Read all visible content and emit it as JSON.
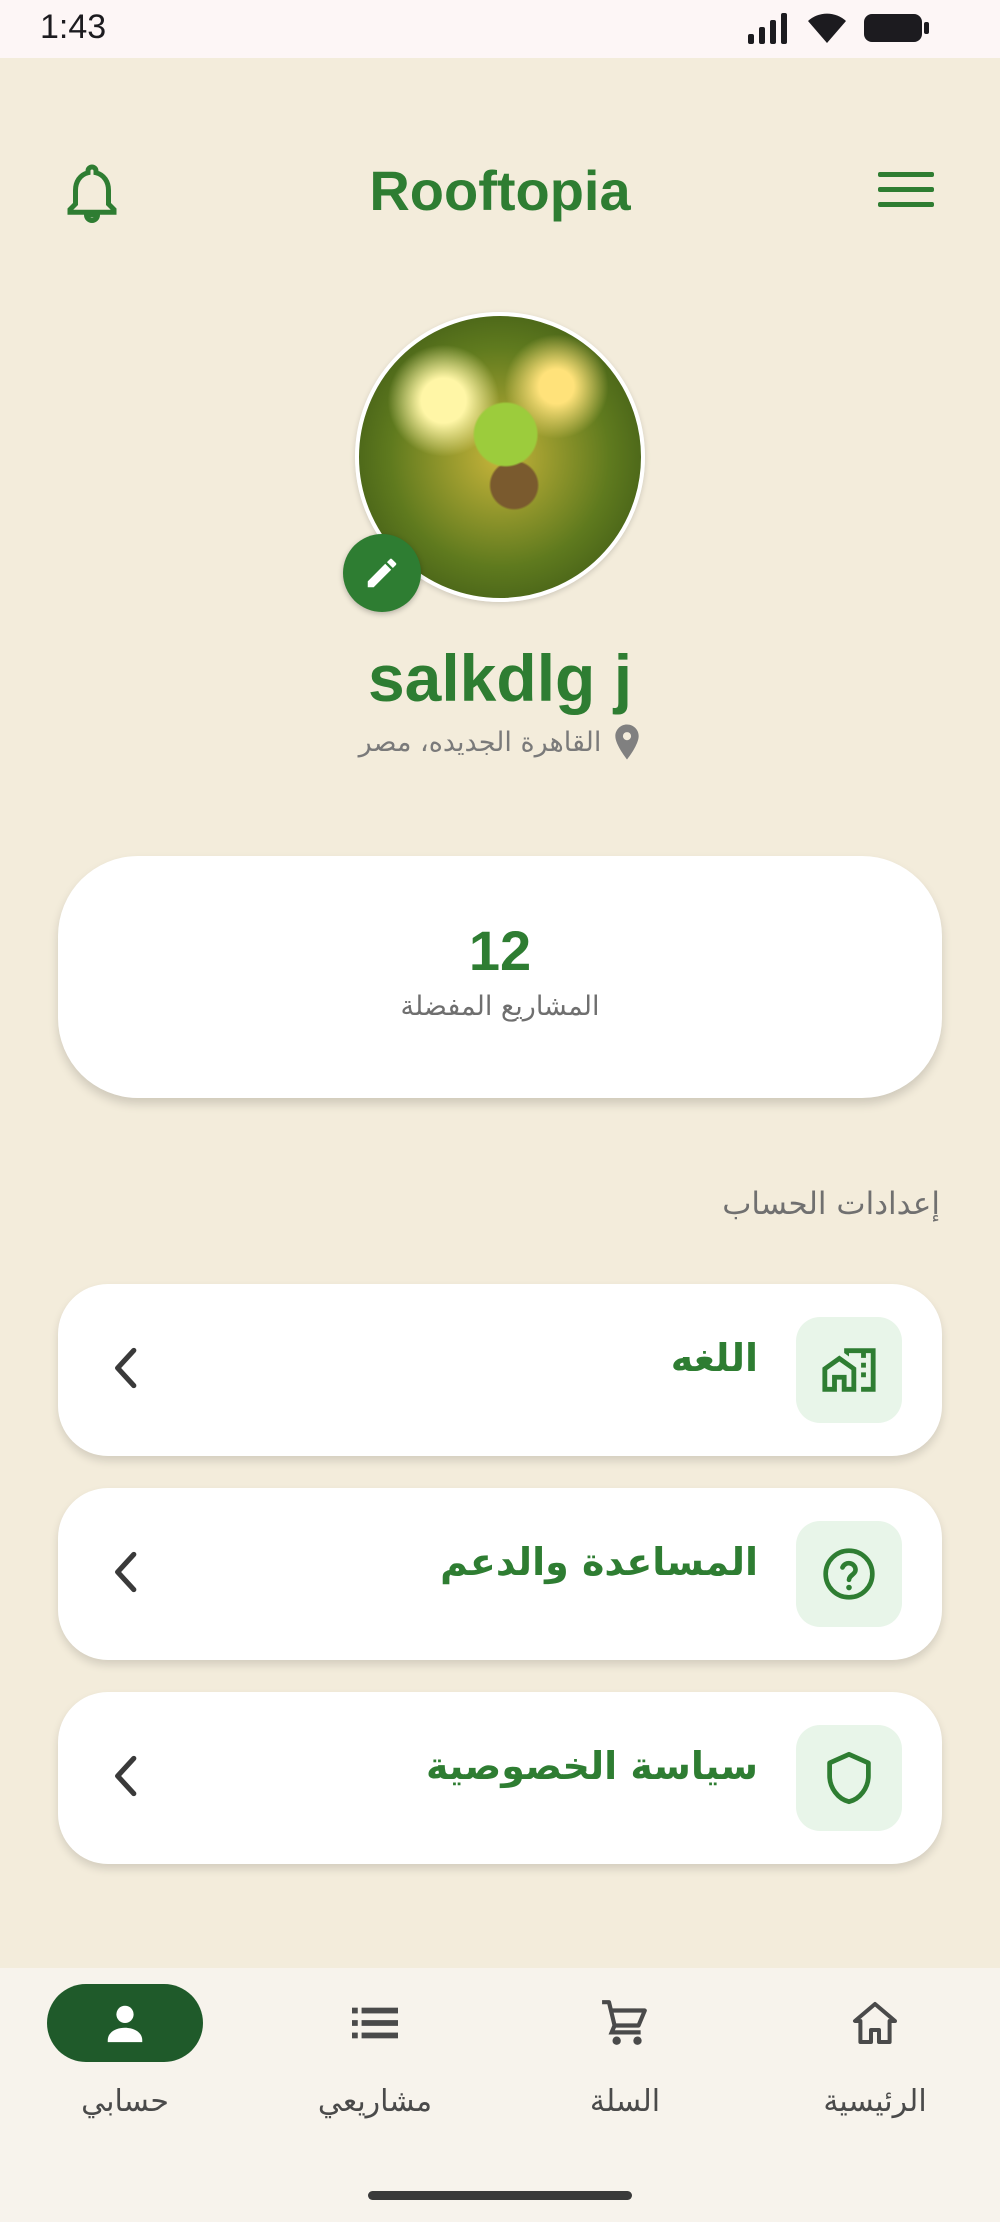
{
  "status_bar": {
    "time": "1:43"
  },
  "header": {
    "title": "Rooftopia"
  },
  "profile": {
    "name": "salkdlg j",
    "location": "القاهرة الجديده، مصر"
  },
  "stats": {
    "value": "12",
    "label": "المشاريع المفضلة"
  },
  "settings": {
    "section_title": "إعدادات الحساب",
    "items": [
      {
        "label": "اللغه",
        "icon": "home-work-icon"
      },
      {
        "label": "المساعدة والدعم",
        "icon": "help-circle-icon"
      },
      {
        "label": "سياسة الخصوصية",
        "icon": "shield-icon"
      }
    ]
  },
  "bottom_nav": {
    "items": [
      {
        "label": "حسابي",
        "icon": "person-icon",
        "active": true
      },
      {
        "label": "مشاريعي",
        "icon": "list-icon",
        "active": false
      },
      {
        "label": "السلة",
        "icon": "cart-icon",
        "active": false
      },
      {
        "label": "الرئيسية",
        "icon": "home-icon",
        "active": false
      }
    ]
  },
  "colors": {
    "primary": "#2e7d32",
    "nav_active": "#1f5a2a",
    "background": "#f3ecdb",
    "icon_box": "#e8f5e9"
  }
}
